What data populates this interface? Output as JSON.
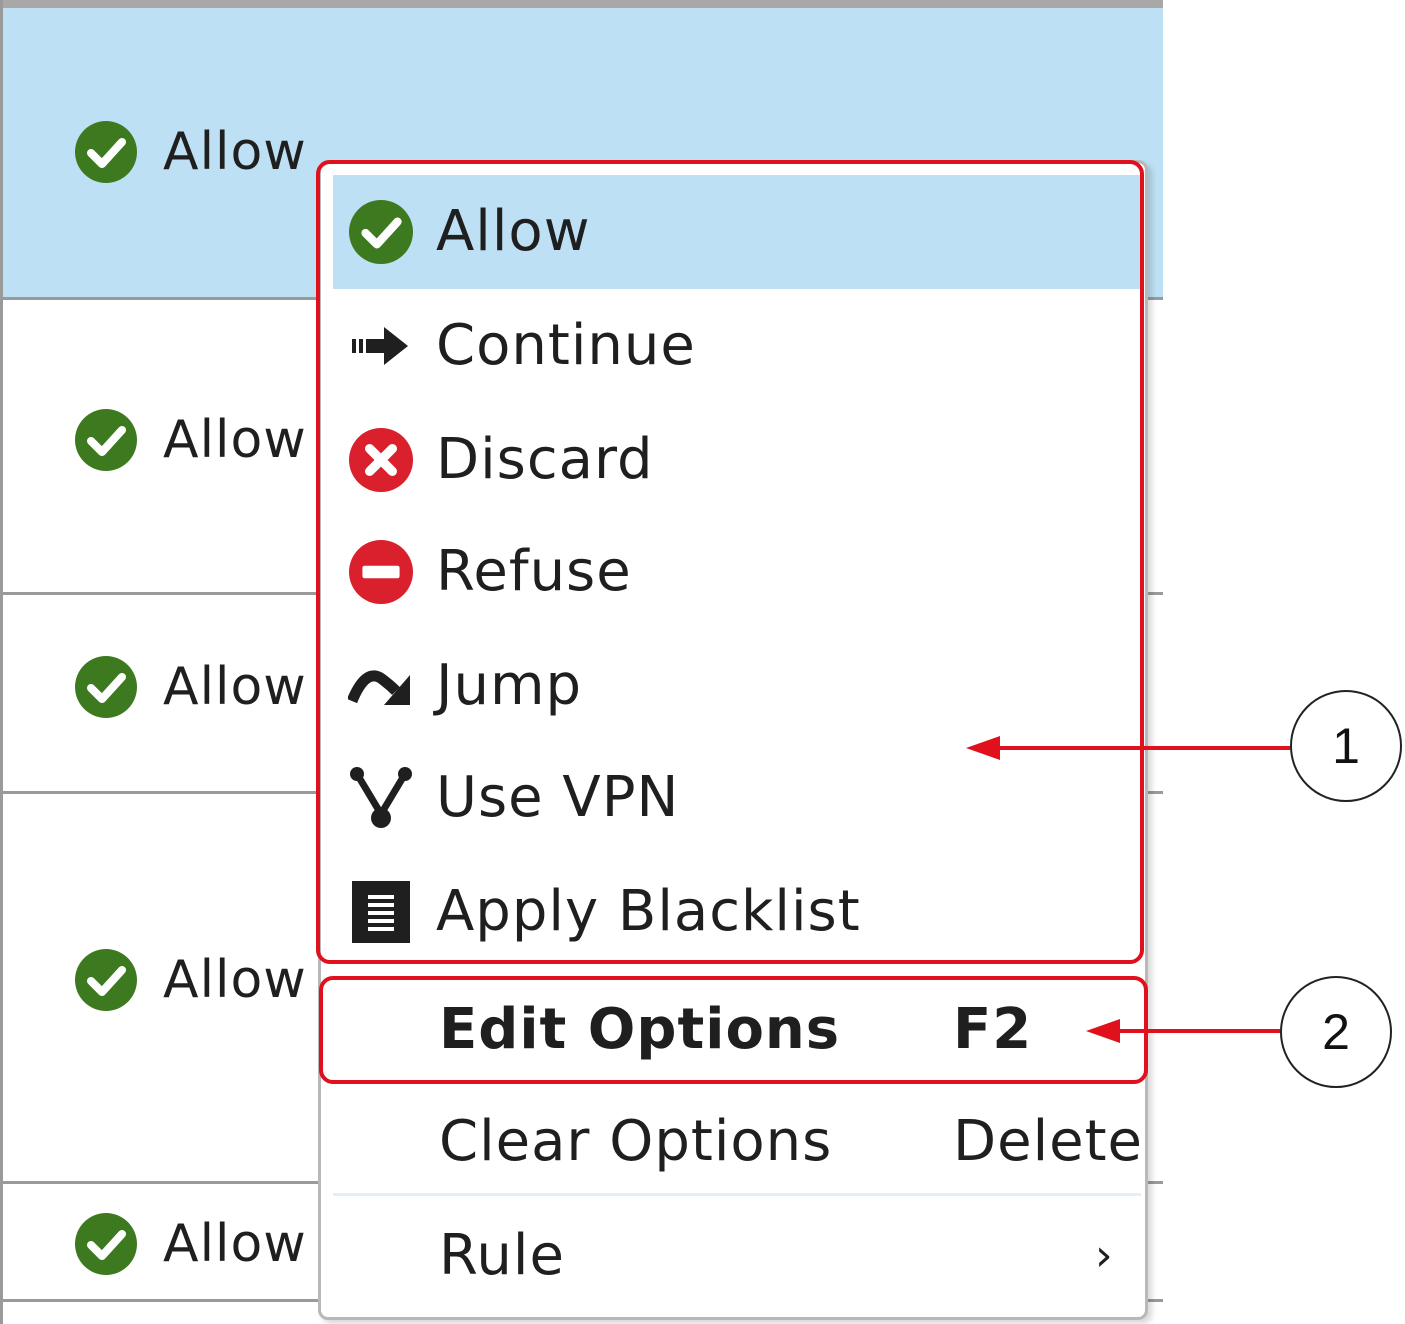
{
  "table": {
    "rows": [
      {
        "action": "Allow",
        "selected": true
      },
      {
        "action": "Allow",
        "selected": false
      },
      {
        "action": "Allow",
        "selected": false
      },
      {
        "action": "Allow",
        "selected": false
      },
      {
        "action": "Allow",
        "selected": false
      }
    ]
  },
  "menu": {
    "actions": [
      {
        "label": "Allow",
        "icon": "check-circle-icon",
        "highlighted": true
      },
      {
        "label": "Continue",
        "icon": "continue-arrow-icon"
      },
      {
        "label": "Discard",
        "icon": "discard-x-circle-icon"
      },
      {
        "label": "Refuse",
        "icon": "refuse-minus-circle-icon"
      },
      {
        "label": "Jump",
        "icon": "jump-arrow-icon"
      },
      {
        "label": "Use VPN",
        "icon": "vpn-fork-icon"
      },
      {
        "label": "Apply Blacklist",
        "icon": "blacklist-list-icon"
      }
    ],
    "edit_options": {
      "label": "Edit Options",
      "shortcut": "F2"
    },
    "clear_options": {
      "label": "Clear Options",
      "shortcut": "Delete"
    },
    "rule": {
      "label": "Rule",
      "submenu_indicator": "›"
    }
  },
  "callouts": {
    "one": "1",
    "two": "2"
  },
  "colors": {
    "selection": "#bde0f4",
    "allow_green": "#3d7a1f",
    "discard_red": "#d9202c",
    "callout_red": "#e0101c"
  }
}
